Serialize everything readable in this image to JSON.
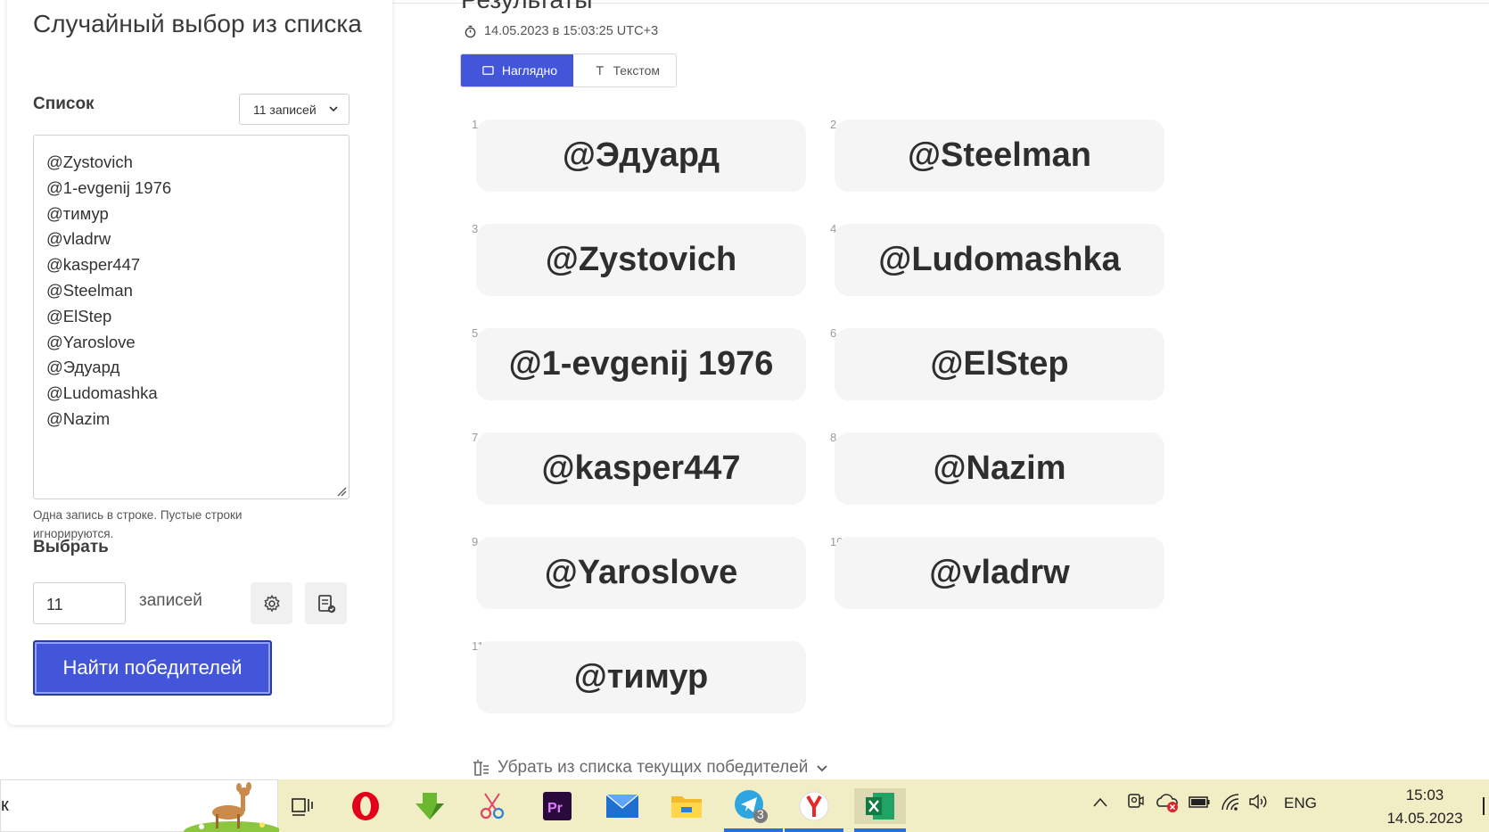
{
  "sidebar": {
    "title": "Случайный выбор из списка",
    "list_label": "Список",
    "count_select": "11 записей",
    "entries": [
      "@Zystovich",
      "@1-evgenij 1976",
      "@тимур",
      "@vladrw",
      "@kasper447",
      "@Steelman",
      "@ElStep",
      "@Yaroslove",
      "@Эдуард",
      "@Ludomashka",
      "@Nazim"
    ],
    "hint": "Одна запись в строке. Пустые строки игнорируются.",
    "pick_label": "Выбрать",
    "pick_value": "11",
    "pick_unit": "записей",
    "submit": "Найти победителей"
  },
  "results": {
    "title": "Результаты",
    "timestamp": "14.05.2023 в 15:03:25 UTC+3",
    "view_visual": "Наглядно",
    "view_text": "Текстом",
    "winners": [
      {
        "n": "1",
        "name": "@Эдуард"
      },
      {
        "n": "2",
        "name": "@Steelman"
      },
      {
        "n": "3",
        "name": "@Zystovich"
      },
      {
        "n": "4",
        "name": "@Ludomashka"
      },
      {
        "n": "5",
        "name": "@1-evgenij 1976"
      },
      {
        "n": "6",
        "name": "@ElStep"
      },
      {
        "n": "7",
        "name": "@kasper447"
      },
      {
        "n": "8",
        "name": "@Nazim"
      },
      {
        "n": "9",
        "name": "@Yaroslove"
      },
      {
        "n": "10",
        "name": "@vladrw"
      },
      {
        "n": "11",
        "name": "@тимур"
      }
    ],
    "remove_link": "Убрать из списка текущих победителей"
  },
  "taskbar": {
    "search_partial": "к",
    "telegram_badge": "3",
    "lang": "ENG",
    "time": "15:03",
    "date": "14.05.2023",
    "colors": {
      "accent": "#4356d9",
      "taskbar": "#f1edc4",
      "tile": "#f5f5f5"
    }
  }
}
